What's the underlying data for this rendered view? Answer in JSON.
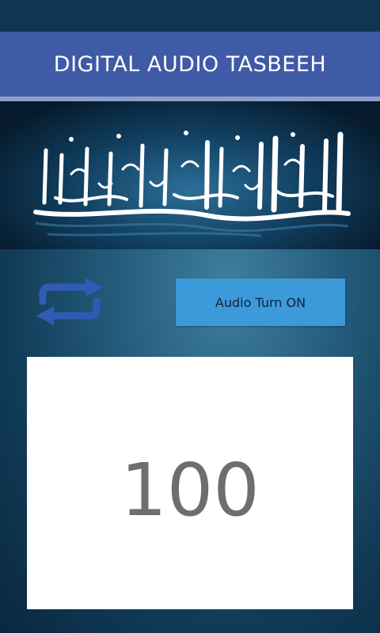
{
  "header": {
    "title": "DIGITAL AUDIO TASBEEH"
  },
  "banner": {
    "image": "shahada-calligraphy"
  },
  "controls": {
    "repeat_icon": "repeat-icon",
    "audio_button_label": "Audio Turn ON"
  },
  "counter": {
    "value": "100"
  },
  "colors": {
    "title_bar": "#3f5aa6",
    "audio_button": "#3c9adb",
    "repeat_icon": "#2f5bb5",
    "counter_text": "#6e6e6e"
  }
}
